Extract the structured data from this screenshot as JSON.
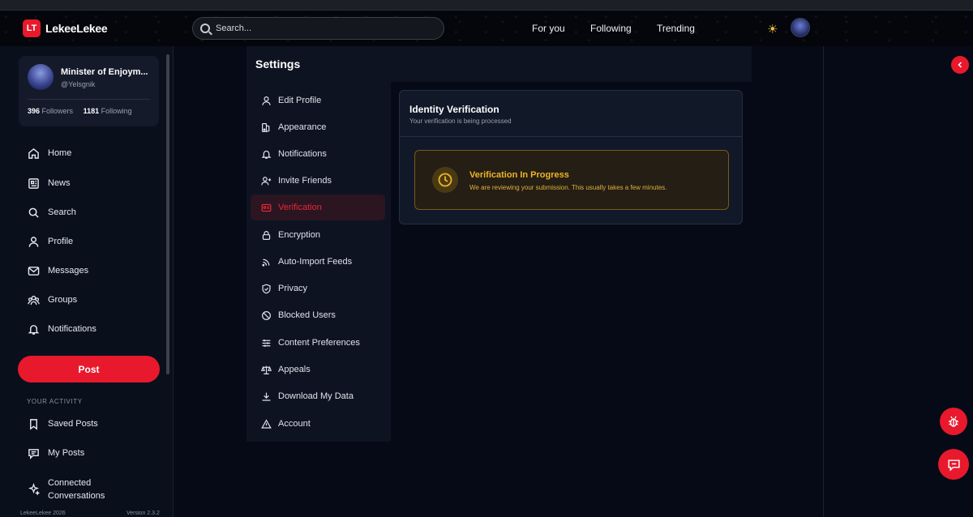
{
  "app": {
    "logo_mark": "LT",
    "logo_text": "LekeeLekee"
  },
  "search": {
    "placeholder": "Search..."
  },
  "topnav": {
    "for_you": "For you",
    "following": "Following",
    "trending": "Trending"
  },
  "profile": {
    "name": "Minister of Enjoym...",
    "handle": "@Yelsgnik",
    "followers_count": "396",
    "followers_label": "Followers",
    "following_count": "1181",
    "following_label": "Following"
  },
  "nav": [
    {
      "label": "Home",
      "icon": "home-icon"
    },
    {
      "label": "News",
      "icon": "news-icon"
    },
    {
      "label": "Search",
      "icon": "search-icon"
    },
    {
      "label": "Profile",
      "icon": "user-icon"
    },
    {
      "label": "Messages",
      "icon": "mail-icon"
    },
    {
      "label": "Groups",
      "icon": "groups-icon"
    },
    {
      "label": "Notifications",
      "icon": "bell-icon"
    }
  ],
  "post_button": "Post",
  "activity": {
    "label": "YOUR ACTIVITY",
    "items": [
      {
        "label": "Saved Posts",
        "icon": "bookmark-icon"
      },
      {
        "label": "My Posts",
        "icon": "posts-icon"
      },
      {
        "label_line1": "Connected",
        "label_line2": "Conversations",
        "icon": "sparkle-icon"
      }
    ]
  },
  "footer": {
    "left": "LekeeLekee 2026",
    "right": "Version 2.3.2"
  },
  "settings": {
    "title": "Settings",
    "menu": [
      {
        "label": "Edit Profile",
        "icon": "user-icon"
      },
      {
        "label": "Appearance",
        "icon": "palette-icon"
      },
      {
        "label": "Notifications",
        "icon": "bell-icon"
      },
      {
        "label": "Invite Friends",
        "icon": "user-plus-icon"
      },
      {
        "label": "Verification",
        "icon": "id-card-icon",
        "active": true
      },
      {
        "label": "Encryption",
        "icon": "lock-icon"
      },
      {
        "label": "Auto-Import Feeds",
        "icon": "rss-icon"
      },
      {
        "label": "Privacy",
        "icon": "shield-icon"
      },
      {
        "label": "Blocked Users",
        "icon": "block-icon"
      },
      {
        "label": "Content Preferences",
        "icon": "sliders-icon"
      },
      {
        "label": "Appeals",
        "icon": "scale-icon"
      },
      {
        "label": "Download My Data",
        "icon": "download-icon"
      },
      {
        "label": "Account",
        "icon": "warning-icon"
      }
    ]
  },
  "verification": {
    "title": "Identity Verification",
    "subtitle": "Your verification is being processed",
    "alert_title": "Verification In Progress",
    "alert_text": "We are reviewing your submission. This usually takes a few minutes."
  },
  "colors": {
    "accent": "#e8192c",
    "warning": "#f0b429",
    "background": "#060a16"
  }
}
